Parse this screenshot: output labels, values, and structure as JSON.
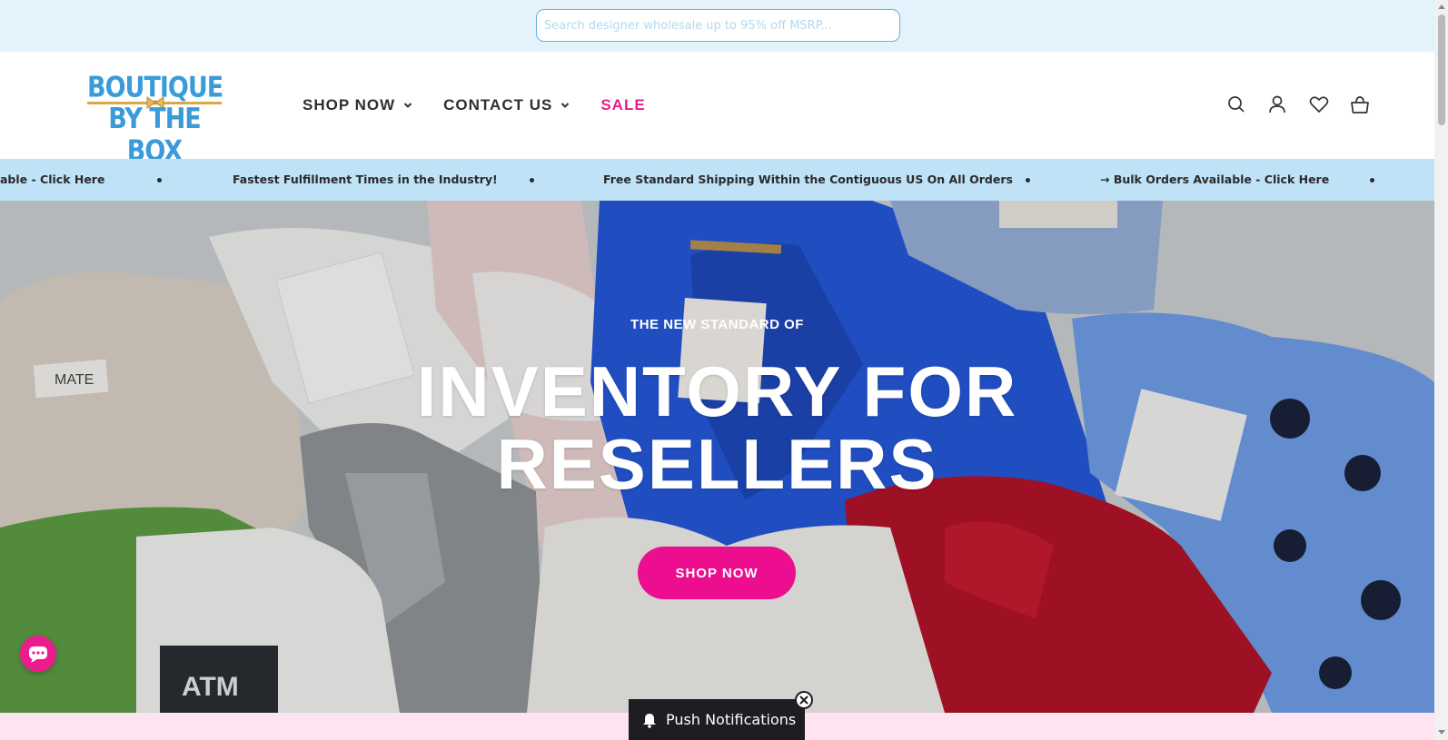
{
  "search": {
    "placeholder": "Search designer wholesale up to 95% off MSRP..."
  },
  "logo": {
    "line1": "BOUTIQUE",
    "line2": "BY THE BOX"
  },
  "nav": {
    "items": [
      {
        "label": "SHOP NOW",
        "has_dropdown": true
      },
      {
        "label": "CONTACT US",
        "has_dropdown": true
      },
      {
        "label": "SALE",
        "has_dropdown": false,
        "color": "#ec1c8f"
      }
    ]
  },
  "header_icons": [
    "search-icon",
    "account-icon",
    "wishlist-heart-icon",
    "cart-icon"
  ],
  "announcement": {
    "items": [
      "able - Click Here",
      "Fastest Fulfillment Times in the Industry!",
      "Free Standard Shipping Within the Contiguous US On All Orders",
      "→ Bulk Orders Available - Click Here"
    ]
  },
  "hero": {
    "eyebrow": "THE NEW STANDARD OF",
    "headline_line1": "INVENTORY FOR",
    "headline_line2": "RESELLERS",
    "cta_label": "SHOP NOW",
    "tags": {
      "mate": "MATE",
      "atm": "ATM"
    }
  },
  "push": {
    "label": "Push Notifications"
  },
  "colors": {
    "brand_blue": "#3b9bd9",
    "brand_pink": "#ec1c8f",
    "topbar_bg": "#e3f2fb",
    "announce_bg": "#bfe2f7",
    "footer_pink": "#fde4f0"
  }
}
